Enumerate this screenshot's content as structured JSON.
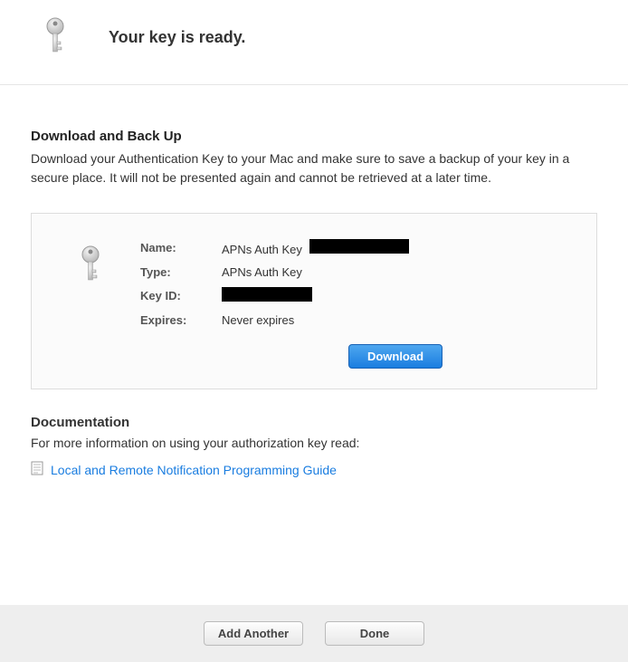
{
  "header": {
    "title": "Your key is ready."
  },
  "section1": {
    "heading": "Download and Back Up",
    "body": "Download your Authentication Key to your Mac and make sure to save a backup of your key in a secure place. It will not be presented again and cannot be retrieved at a later time."
  },
  "details": {
    "labels": {
      "name": "Name:",
      "type": "Type:",
      "keyid": "Key ID:",
      "expires": "Expires:"
    },
    "values": {
      "name_prefix": "APNs Auth Key",
      "type": "APNs Auth Key",
      "expires": "Never expires"
    },
    "download_label": "Download"
  },
  "documentation": {
    "heading": "Documentation",
    "body": "For more information on using your authorization key read:",
    "link_label": "Local and Remote Notification Programming Guide"
  },
  "footer": {
    "add_another": "Add Another",
    "done": "Done"
  }
}
